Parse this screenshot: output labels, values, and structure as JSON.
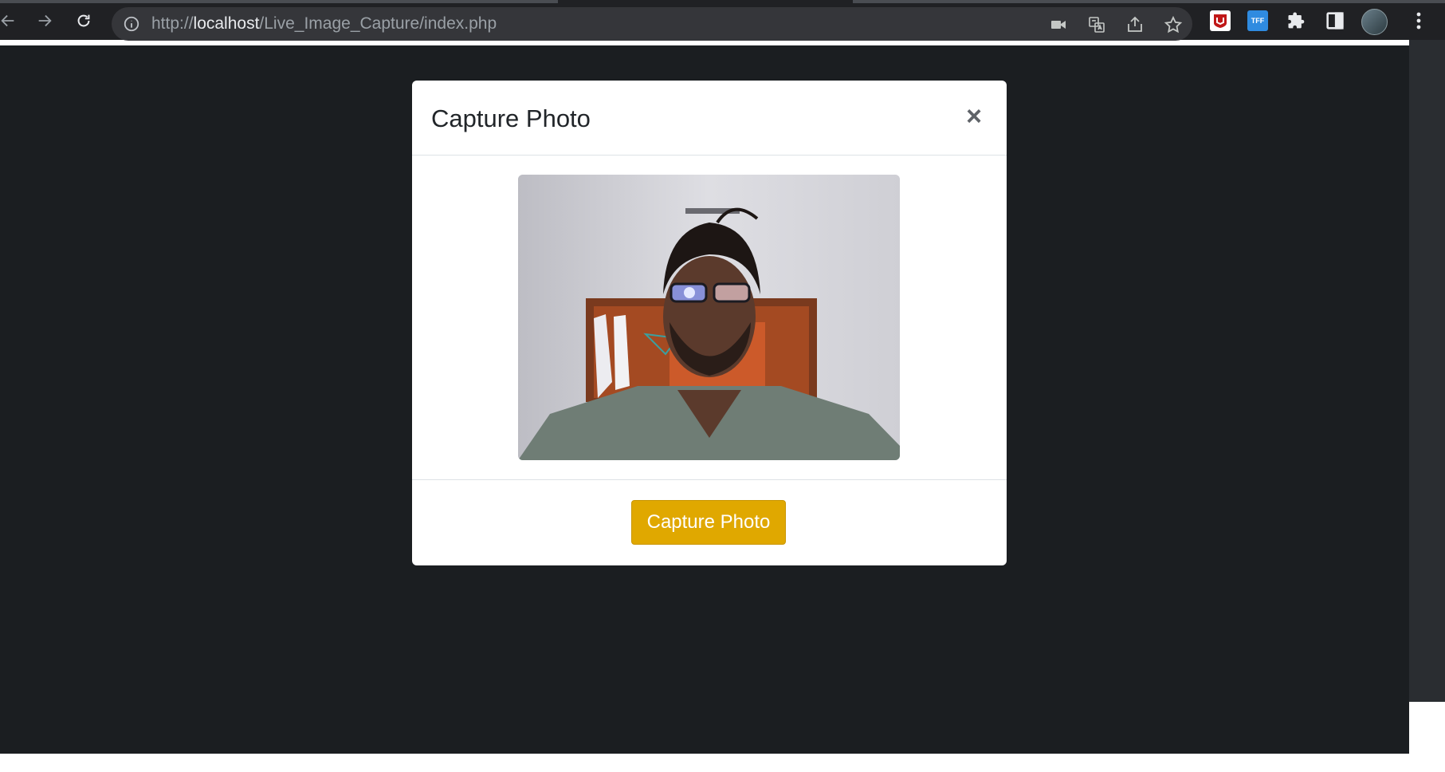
{
  "browser": {
    "url_scheme": "http://",
    "url_host": "localhost",
    "url_path": "/Live_Image_Capture/index.php",
    "icons": [
      "back-icon",
      "forward-icon",
      "reload-icon",
      "info-icon",
      "camera-icon",
      "translate-icon",
      "share-icon",
      "star-icon",
      "mcafee-extension-icon",
      "tff-extension-icon",
      "extensions-puzzle-icon",
      "side-panel-icon",
      "profile-avatar",
      "more-menu-icon"
    ],
    "tff_label": "TFF"
  },
  "modal": {
    "title": "Capture Photo",
    "close_label": "×",
    "capture_button_label": "Capture Photo"
  },
  "colors": {
    "page_background": "#1b1e21",
    "button_warning": "#e0a800",
    "browser_chrome": "#202124"
  }
}
